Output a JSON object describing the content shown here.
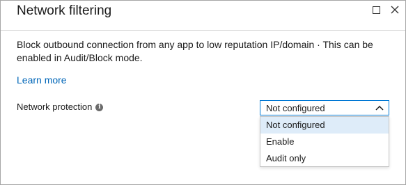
{
  "panel": {
    "title": "Network filtering",
    "description": "Block outbound connection from any app to low reputation IP/domain · This can be enabled in Audit/Block mode.",
    "learn_more": "Learn more"
  },
  "field": {
    "label": "Network protection",
    "selected_value": "Not configured",
    "options": [
      "Not configured",
      "Enable",
      "Audit only"
    ]
  },
  "colors": {
    "link": "#0066b8",
    "accent_border": "#0078d4",
    "option_highlight": "#deecf9"
  },
  "icons": {
    "maximize": "maximize-icon",
    "close": "close-icon",
    "info": "info-icon",
    "chevron": "chevron-up-icon"
  }
}
